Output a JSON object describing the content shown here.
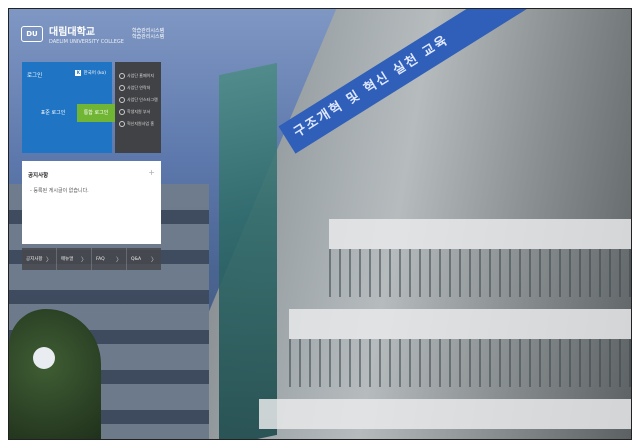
{
  "header": {
    "logo_text": "대림대학교",
    "logo_sub": "DAELIM UNIVERSITY COLLEGE",
    "system_title_line1": "학습관리시스템",
    "system_title_line2": "학습관리시스템"
  },
  "login": {
    "title": "로그인",
    "language": "한국어 (ko)",
    "standard_login": "표준 로그인",
    "integrated_login": "통합 로그인"
  },
  "quick_links": [
    {
      "label": "사업단 홈페이지",
      "icon": "circle-icon"
    },
    {
      "label": "사업단 연락처",
      "icon": "circle-icon"
    },
    {
      "label": "사업단 인스타그램",
      "icon": "circle-icon"
    },
    {
      "label": "학생지원 부서",
      "icon": "circle-icon"
    },
    {
      "label": "혁신지원사업 홈",
      "icon": "circle-icon"
    }
  ],
  "notice": {
    "title": "공지사항",
    "more_icon": "+",
    "empty_message": "- 등록된 게시글이 없습니다."
  },
  "tabs": [
    {
      "label": "공지사항",
      "chevron": "〉"
    },
    {
      "label": "매뉴얼",
      "chevron": "〉"
    },
    {
      "label": "FAQ",
      "chevron": "〉"
    },
    {
      "label": "Q&A",
      "chevron": "〉"
    }
  ],
  "banner": {
    "text": "구조개혁 및 혁신 실천 교육"
  }
}
